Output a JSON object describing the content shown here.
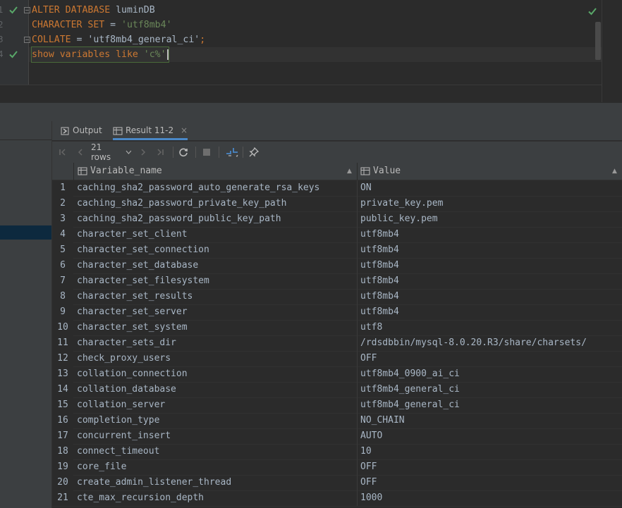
{
  "editor": {
    "gutter_numbers": [
      "1",
      "2",
      "3",
      "4"
    ],
    "lines": [
      {
        "parts": [
          {
            "t": "ALTER DATABASE ",
            "c": "kw"
          },
          {
            "t": "luminDB",
            "c": ""
          }
        ]
      },
      {
        "parts": [
          {
            "t": "CHARACTER SET ",
            "c": "kw"
          },
          {
            "t": "= ",
            "c": ""
          },
          {
            "t": "'utf8mb4'",
            "c": "str"
          }
        ]
      },
      {
        "parts": [
          {
            "t": "COLLATE ",
            "c": "kw"
          },
          {
            "t": "= 'utf8mb4_general_ci'",
            "c": ""
          },
          {
            "t": ";",
            "c": "kw"
          }
        ]
      },
      {
        "parts": [
          {
            "t": "show variables like ",
            "c": "kw"
          },
          {
            "t": "'c%'",
            "c": "str"
          }
        ]
      }
    ]
  },
  "result_tabs": [
    {
      "label": "Output",
      "icon": "output-icon"
    },
    {
      "label": "Result 11-2",
      "icon": "table-icon",
      "active": true
    }
  ],
  "toolbar": {
    "rows_label": "21 rows"
  },
  "table": {
    "columns": [
      "Variable_name",
      "Value"
    ],
    "rows": [
      [
        "1",
        "caching_sha2_password_auto_generate_rsa_keys",
        "ON"
      ],
      [
        "2",
        "caching_sha2_password_private_key_path",
        "private_key.pem"
      ],
      [
        "3",
        "caching_sha2_password_public_key_path",
        "public_key.pem"
      ],
      [
        "4",
        "character_set_client",
        "utf8mb4"
      ],
      [
        "5",
        "character_set_connection",
        "utf8mb4"
      ],
      [
        "6",
        "character_set_database",
        "utf8mb4"
      ],
      [
        "7",
        "character_set_filesystem",
        "utf8mb4"
      ],
      [
        "8",
        "character_set_results",
        "utf8mb4"
      ],
      [
        "9",
        "character_set_server",
        "utf8mb4"
      ],
      [
        "10",
        "character_set_system",
        "utf8"
      ],
      [
        "11",
        "character_sets_dir",
        "/rdsdbbin/mysql-8.0.20.R3/share/charsets/"
      ],
      [
        "12",
        "check_proxy_users",
        "OFF"
      ],
      [
        "13",
        "collation_connection",
        "utf8mb4_0900_ai_ci"
      ],
      [
        "14",
        "collation_database",
        "utf8mb4_general_ci"
      ],
      [
        "15",
        "collation_server",
        "utf8mb4_general_ci"
      ],
      [
        "16",
        "completion_type",
        "NO_CHAIN"
      ],
      [
        "17",
        "concurrent_insert",
        "AUTO"
      ],
      [
        "18",
        "connect_timeout",
        "10"
      ],
      [
        "19",
        "core_file",
        "OFF"
      ],
      [
        "20",
        "create_admin_listener_thread",
        "OFF"
      ],
      [
        "21",
        "cte_max_recursion_depth",
        "1000"
      ]
    ]
  },
  "colors": {
    "keyword": "#cc7832",
    "string": "#6a8759",
    "check": "#59a869",
    "accent": "#4a88c7"
  }
}
